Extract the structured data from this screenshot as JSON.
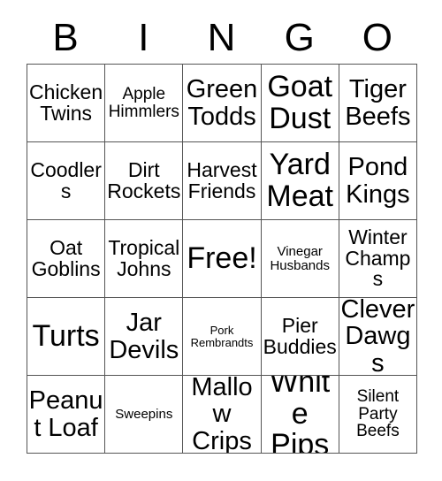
{
  "card": {
    "header_letters": [
      "B",
      "I",
      "N",
      "G",
      "O"
    ],
    "rows": [
      [
        {
          "text": "Chicken Twins",
          "size": "md"
        },
        {
          "text": "Apple Himmlers",
          "size": "sm"
        },
        {
          "text": "Green Todds",
          "size": "lg"
        },
        {
          "text": "Goat Dust",
          "size": "xl"
        },
        {
          "text": "Tiger Beefs",
          "size": "lg"
        }
      ],
      [
        {
          "text": "Coodlers",
          "size": "md"
        },
        {
          "text": "Dirt Rockets",
          "size": "md"
        },
        {
          "text": "Harvest Friends",
          "size": "md"
        },
        {
          "text": "Yard Meat",
          "size": "xl"
        },
        {
          "text": "Pond Kings",
          "size": "lg"
        }
      ],
      [
        {
          "text": "Oat Goblins",
          "size": "md"
        },
        {
          "text": "Tropical Johns",
          "size": "md"
        },
        {
          "text": "Free!",
          "size": "xl"
        },
        {
          "text": "Vinegar Husbands",
          "size": "xs"
        },
        {
          "text": "Winter Champs",
          "size": "md"
        }
      ],
      [
        {
          "text": "Turts",
          "size": "xl"
        },
        {
          "text": "Jar Devils",
          "size": "lg"
        },
        {
          "text": "Pork Rembrandts",
          "size": "xxs"
        },
        {
          "text": "Pier Buddies",
          "size": "md"
        },
        {
          "text": "Clever Dawgs",
          "size": "lg"
        }
      ],
      [
        {
          "text": "Peanut Loaf",
          "size": "lg"
        },
        {
          "text": "Sweepins",
          "size": "xs"
        },
        {
          "text": "Mallow Crips",
          "size": "lg"
        },
        {
          "text": "White Pips",
          "size": "xl"
        },
        {
          "text": "Silent Party Beefs",
          "size": "sm"
        }
      ]
    ]
  },
  "colors": {
    "background": "#ffffff",
    "text": "#000000",
    "border": "#555555"
  }
}
